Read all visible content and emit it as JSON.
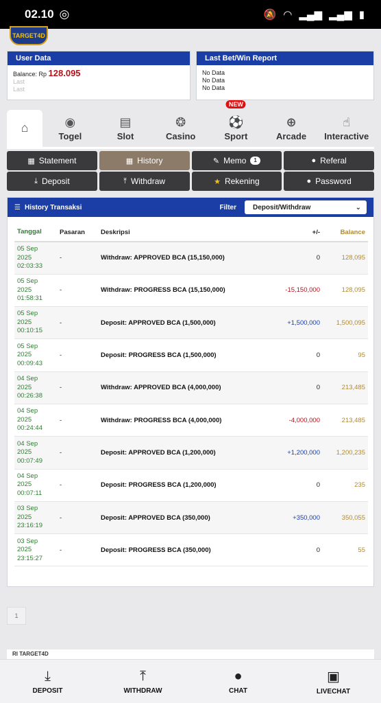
{
  "status": {
    "time": "02.10"
  },
  "logo": {
    "alt": "TARGET4D"
  },
  "user_data": {
    "title": "User Data",
    "balance_label": "Balance: Rp",
    "balance_value": "128.095",
    "line2": "Last",
    "line3": "Last"
  },
  "last_bet": {
    "title": "Last Bet/Win Report",
    "rows": [
      "No Data",
      "No Data",
      "No Data"
    ]
  },
  "tabs": [
    {
      "label": "",
      "icon": "home-icon"
    },
    {
      "label": "Togel",
      "icon": "lottery-icon"
    },
    {
      "label": "Slot",
      "icon": "slot-icon"
    },
    {
      "label": "Casino",
      "icon": "casino-chip-icon"
    },
    {
      "label": "Sport",
      "icon": "soccer-ball-icon",
      "badge": "NEW"
    },
    {
      "label": "Arcade",
      "icon": "crosshair-icon"
    },
    {
      "label": "Interactive",
      "icon": "touch-icon"
    }
  ],
  "buttons": [
    {
      "label": "Statement",
      "icon": "calendar-icon"
    },
    {
      "label": "History",
      "icon": "calendar-icon",
      "active": true
    },
    {
      "label": "Memo",
      "icon": "edit-icon",
      "count": "1"
    },
    {
      "label": "Referal",
      "icon": "user-icon"
    },
    {
      "label": "Deposit",
      "icon": "download-icon"
    },
    {
      "label": "Withdraw",
      "icon": "upload-icon"
    },
    {
      "label": "Rekening",
      "icon": "star-icon"
    },
    {
      "label": "Password",
      "icon": "user-icon"
    }
  ],
  "history": {
    "title": "History Transaksi",
    "filter_label": "Filter",
    "filter_value": "Deposit/Withdraw",
    "columns": [
      "Tanggal",
      "Pasaran",
      "Deskripsi",
      "+/-",
      "Balance"
    ],
    "rows": [
      {
        "date": "05 Sep",
        "year": "2025",
        "time": "02:03:33",
        "pasaran": "-",
        "desc": "Withdraw: APPROVED BCA (15,150,000)",
        "amount": "0",
        "balance": "128,095",
        "sign": "zero"
      },
      {
        "date": "05 Sep",
        "year": "2025",
        "time": "01:58:31",
        "pasaran": "-",
        "desc": "Withdraw: PROGRESS BCA (15,150,000)",
        "amount": "-15,150,000",
        "balance": "128,095",
        "sign": "neg"
      },
      {
        "date": "05 Sep",
        "year": "2025",
        "time": "00:10:15",
        "pasaran": "-",
        "desc": "Deposit: APPROVED BCA (1,500,000)",
        "amount": "+1,500,000",
        "balance": "1,500,095",
        "sign": "pos"
      },
      {
        "date": "05 Sep",
        "year": "2025",
        "time": "00:09:43",
        "pasaran": "-",
        "desc": "Deposit: PROGRESS BCA (1,500,000)",
        "amount": "0",
        "balance": "95",
        "sign": "zero"
      },
      {
        "date": "04 Sep",
        "year": "2025",
        "time": "00:26:38",
        "pasaran": "-",
        "desc": "Withdraw: APPROVED BCA (4,000,000)",
        "amount": "0",
        "balance": "213,485",
        "sign": "zero"
      },
      {
        "date": "04 Sep",
        "year": "2025",
        "time": "00:24:44",
        "pasaran": "-",
        "desc": "Withdraw: PROGRESS BCA (4,000,000)",
        "amount": "-4,000,000",
        "balance": "213,485",
        "sign": "neg"
      },
      {
        "date": "04 Sep",
        "year": "2025",
        "time": "00:07:49",
        "pasaran": "-",
        "desc": "Deposit: APPROVED BCA (1,200,000)",
        "amount": "+1,200,000",
        "balance": "1,200,235",
        "sign": "pos"
      },
      {
        "date": "04 Sep",
        "year": "2025",
        "time": "00:07:11",
        "pasaran": "-",
        "desc": "Deposit: PROGRESS BCA (1,200,000)",
        "amount": "0",
        "balance": "235",
        "sign": "zero"
      },
      {
        "date": "03 Sep",
        "year": "2025",
        "time": "23:16:19",
        "pasaran": "-",
        "desc": "Deposit: APPROVED BCA (350,000)",
        "amount": "+350,000",
        "balance": "350,055",
        "sign": "pos"
      },
      {
        "date": "03 Sep",
        "year": "2025",
        "time": "23:15:27",
        "pasaran": "-",
        "desc": "Deposit: PROGRESS BCA (350,000)",
        "amount": "0",
        "balance": "55",
        "sign": "zero"
      }
    ]
  },
  "pagination": {
    "page": "1"
  },
  "footer_text": "RI TARGET4D",
  "bottom_nav": [
    {
      "label": "DEPOSIT",
      "icon": "download-tray-icon"
    },
    {
      "label": "WITHDRAW",
      "icon": "upload-tray-icon"
    },
    {
      "label": "CHAT",
      "icon": "chat-bubble-icon"
    },
    {
      "label": "LIVECHAT",
      "icon": "livechat-icon"
    }
  ]
}
